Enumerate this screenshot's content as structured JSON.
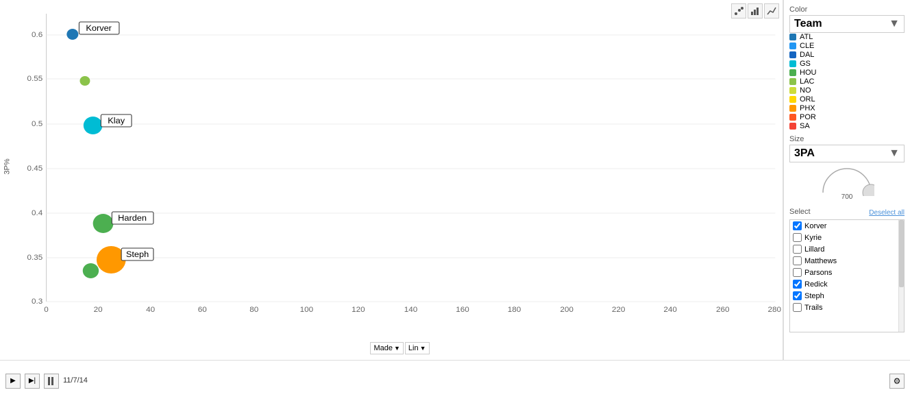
{
  "toolbar": {
    "scatter_icon": "⠿",
    "bar_icon": "▦",
    "line_icon": "∕"
  },
  "color_panel": {
    "label": "Color",
    "selected": "Team",
    "legend": [
      {
        "team": "ATL",
        "color": "#1F77B4"
      },
      {
        "team": "CLE",
        "color": "#2196F3"
      },
      {
        "team": "DAL",
        "color": "#1565C0"
      },
      {
        "team": "GS",
        "color": "#00BCD4"
      },
      {
        "team": "HOU",
        "color": "#4CAF50"
      },
      {
        "team": "LAC",
        "color": "#8BC34A"
      },
      {
        "team": "NO",
        "color": "#CDDC39"
      },
      {
        "team": "ORL",
        "color": "#FFD700"
      },
      {
        "team": "PHX",
        "color": "#FF9800"
      },
      {
        "team": "POR",
        "color": "#FF5722"
      },
      {
        "team": "SA",
        "color": "#F44336"
      }
    ]
  },
  "size_panel": {
    "label": "Size",
    "selected": "3PA",
    "max_value": "700"
  },
  "select_panel": {
    "label": "Select",
    "deselect_label": "Deselect all",
    "items": [
      {
        "name": "Korver",
        "checked": true
      },
      {
        "name": "Kyrie",
        "checked": false
      },
      {
        "name": "Lillard",
        "checked": false
      },
      {
        "name": "Matthews",
        "checked": false
      },
      {
        "name": "Parsons",
        "checked": false
      },
      {
        "name": "Redick",
        "checked": true
      },
      {
        "name": "Steph",
        "checked": true
      },
      {
        "name": "Trails",
        "checked": false
      }
    ]
  },
  "chart": {
    "y_axis_label": "3P%",
    "x_axis_label": "Made",
    "y_ticks": [
      "0.3",
      "0.35",
      "0.4",
      "0.45",
      "0.5",
      "0.55",
      "0.6"
    ],
    "x_ticks": [
      "0",
      "20",
      "40",
      "60",
      "80",
      "100",
      "120",
      "140",
      "160",
      "180",
      "200",
      "220",
      "240",
      "260",
      "280"
    ],
    "data_points": [
      {
        "label": "Korver",
        "x": 10,
        "y": 0.601,
        "color": "#1F77B4",
        "size": 8
      },
      {
        "label": "Klay",
        "x": 18,
        "y": 0.499,
        "color": "#00BCD4",
        "size": 14
      },
      {
        "label": "",
        "x": 15,
        "y": 0.549,
        "color": "#8BC34A",
        "size": 8
      },
      {
        "label": "Harden",
        "x": 22,
        "y": 0.388,
        "color": "#4CAF50",
        "size": 16
      },
      {
        "label": "Steph",
        "x": 25,
        "y": 0.347,
        "color": "#FF9800",
        "size": 22
      },
      {
        "label": "",
        "x": 17,
        "y": 0.335,
        "color": "#4CAF50",
        "size": 12
      }
    ]
  },
  "bottom_bar": {
    "play_label": "▶",
    "step_forward_label": "▶|",
    "pause_label": "⏸",
    "date": "11/7/14",
    "x_dropdown_label": "Made",
    "lin_label": "Lin",
    "settings_icon": "⚙"
  }
}
